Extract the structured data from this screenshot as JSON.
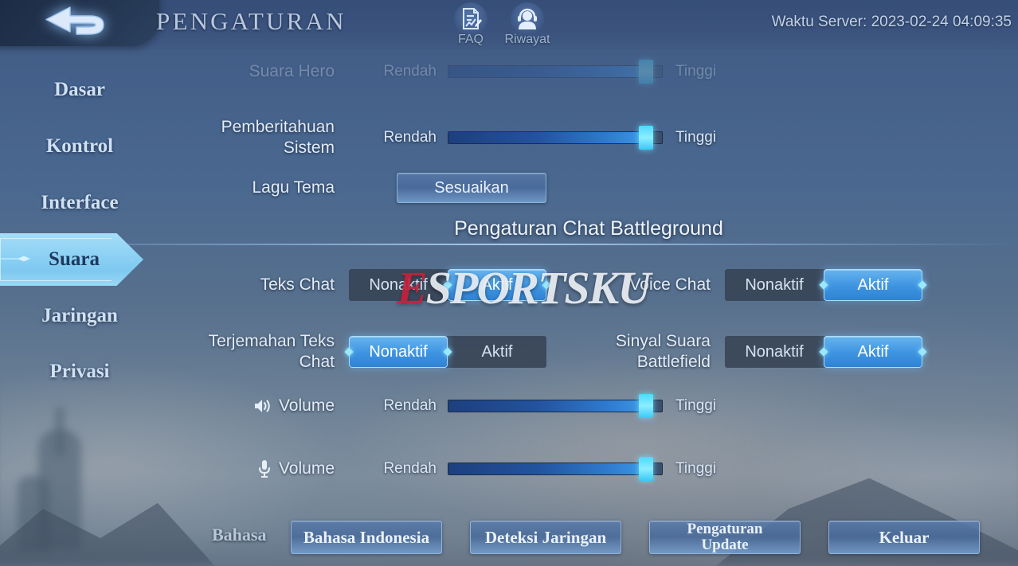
{
  "header": {
    "title": "PENGATURAN",
    "back_icon": "back-arrow-icon",
    "faq_label": "FAQ",
    "faq_icon": "document-pen-icon",
    "riwayat_label": "Riwayat",
    "riwayat_icon": "support-agent-icon",
    "server_time": "Waktu Server: 2023-02-24 04:09:35"
  },
  "sidebar": {
    "items": [
      {
        "label": "Dasar",
        "active": false
      },
      {
        "label": "Kontrol",
        "active": false
      },
      {
        "label": "Interface",
        "active": false
      },
      {
        "label": "Suara",
        "active": true
      },
      {
        "label": "Jaringan",
        "active": false
      },
      {
        "label": "Privasi",
        "active": false
      }
    ]
  },
  "sliders": {
    "low_label": "Rendah",
    "high_label": "Tinggi"
  },
  "rows": {
    "suara_hero": {
      "label": "Suara Hero",
      "value": 93
    },
    "pemberitahuan_sistem": {
      "label": "Pemberitahuan Sistem",
      "label_line1": "Pemberitahuan",
      "label_line2": "Sistem",
      "value": 93
    },
    "lagu_tema": {
      "label": "Lagu Tema",
      "button": "Sesuaikan"
    },
    "volume_speaker": {
      "label": "Volume",
      "icon": "speaker-icon",
      "value": 93
    },
    "volume_mic": {
      "label": "Volume",
      "icon": "microphone-icon",
      "value": 93
    }
  },
  "section": {
    "title": "Pengaturan Chat Battleground"
  },
  "toggles": {
    "off_label": "Nonaktif",
    "on_label": "Aktif",
    "items": [
      {
        "label": "Teks Chat",
        "label_line1": "Teks Chat",
        "label_line2": "",
        "selected": "Aktif"
      },
      {
        "label": "Voice Chat",
        "label_line1": "Voice Chat",
        "label_line2": "",
        "selected": "Aktif"
      },
      {
        "label": "Terjemahan Teks Chat",
        "label_line1": "Terjemahan Teks",
        "label_line2": "Chat",
        "selected": "Nonaktif"
      },
      {
        "label": "Sinyal Suara Battlefield",
        "label_line1": "Sinyal Suara",
        "label_line2": "Battlefield",
        "selected": "Aktif"
      }
    ]
  },
  "footer": {
    "bahasa_label": "Bahasa",
    "language_button": "Bahasa Indonesia",
    "network_button": "Deteksi Jaringan",
    "update_button_line1": "Pengaturan",
    "update_button_line2": "Update",
    "exit_button": "Keluar"
  },
  "watermark": {
    "first": "E",
    "rest": "SPORTSKU"
  },
  "colors": {
    "accent_blue": "#3e93e0",
    "handle_cyan": "#8ceeff",
    "active_tab": "#8ed2f4",
    "watermark_red": "#c0233c"
  }
}
